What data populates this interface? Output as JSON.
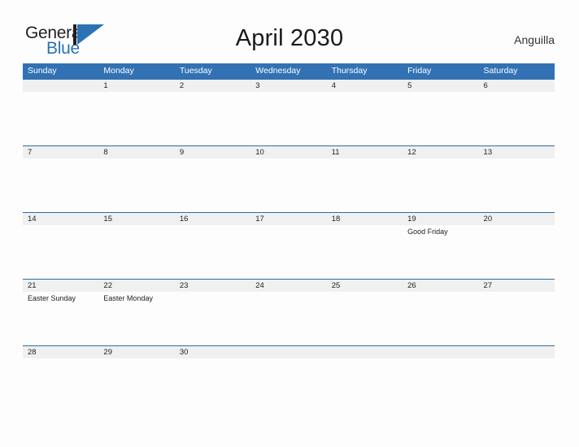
{
  "brand": {
    "name_part1": "General",
    "name_part2": "Blue",
    "logo_icon": "triangle-flag-icon",
    "accent_color": "#2a72b5"
  },
  "header": {
    "title": "April 2030",
    "country": "Anguilla"
  },
  "colors": {
    "header_blue": "#3272b4",
    "row_band_gray": "#f0f0f0",
    "row_border_blue": "#2e6da4",
    "page_background": "#fdfdfd"
  },
  "calendar": {
    "month": "April",
    "year": "2030",
    "weekday_headers": [
      "Sunday",
      "Monday",
      "Tuesday",
      "Wednesday",
      "Thursday",
      "Friday",
      "Saturday"
    ],
    "weeks": [
      {
        "days": [
          {
            "date": "",
            "event": ""
          },
          {
            "date": "1",
            "event": ""
          },
          {
            "date": "2",
            "event": ""
          },
          {
            "date": "3",
            "event": ""
          },
          {
            "date": "4",
            "event": ""
          },
          {
            "date": "5",
            "event": ""
          },
          {
            "date": "6",
            "event": ""
          }
        ]
      },
      {
        "days": [
          {
            "date": "7",
            "event": ""
          },
          {
            "date": "8",
            "event": ""
          },
          {
            "date": "9",
            "event": ""
          },
          {
            "date": "10",
            "event": ""
          },
          {
            "date": "11",
            "event": ""
          },
          {
            "date": "12",
            "event": ""
          },
          {
            "date": "13",
            "event": ""
          }
        ]
      },
      {
        "days": [
          {
            "date": "14",
            "event": ""
          },
          {
            "date": "15",
            "event": ""
          },
          {
            "date": "16",
            "event": ""
          },
          {
            "date": "17",
            "event": ""
          },
          {
            "date": "18",
            "event": ""
          },
          {
            "date": "19",
            "event": "Good Friday"
          },
          {
            "date": "20",
            "event": ""
          }
        ]
      },
      {
        "days": [
          {
            "date": "21",
            "event": "Easter Sunday"
          },
          {
            "date": "22",
            "event": "Easter Monday"
          },
          {
            "date": "23",
            "event": ""
          },
          {
            "date": "24",
            "event": ""
          },
          {
            "date": "25",
            "event": ""
          },
          {
            "date": "26",
            "event": ""
          },
          {
            "date": "27",
            "event": ""
          }
        ]
      },
      {
        "days": [
          {
            "date": "28",
            "event": ""
          },
          {
            "date": "29",
            "event": ""
          },
          {
            "date": "30",
            "event": ""
          },
          {
            "date": "",
            "event": ""
          },
          {
            "date": "",
            "event": ""
          },
          {
            "date": "",
            "event": ""
          },
          {
            "date": "",
            "event": ""
          }
        ]
      }
    ]
  }
}
